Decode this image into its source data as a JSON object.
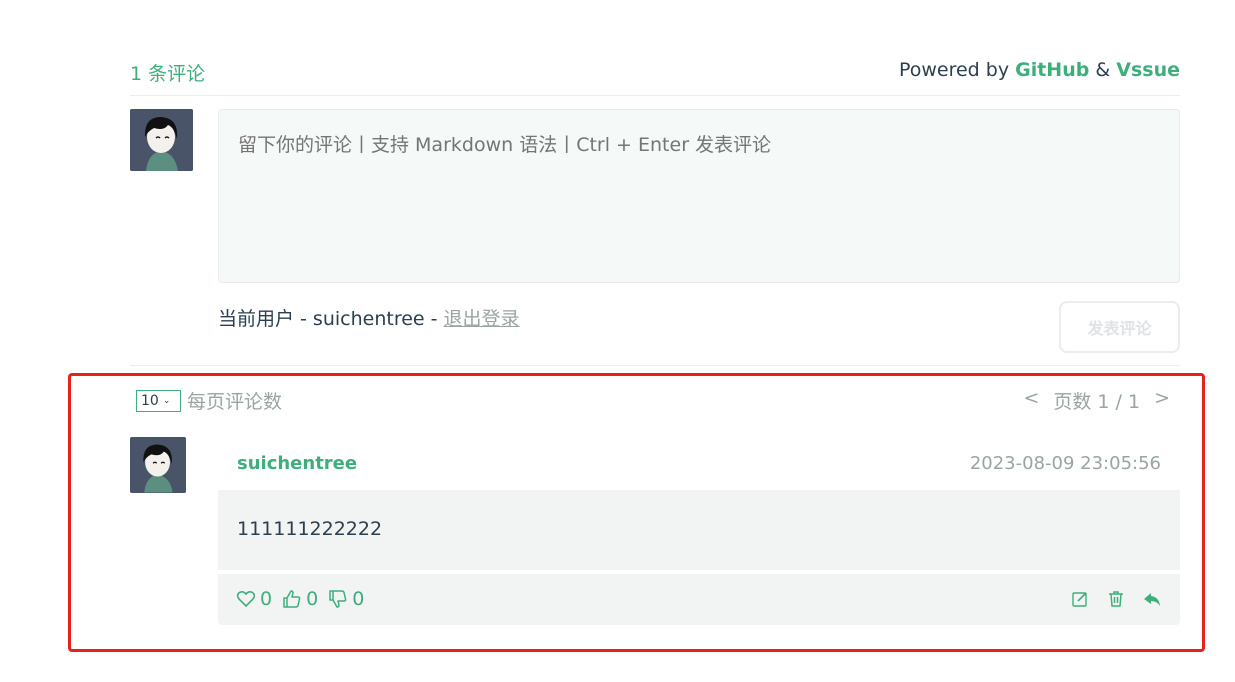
{
  "header": {
    "comment_count": "1 条评论",
    "powered_prefix": "Powered by",
    "github": "GitHub",
    "amp": "&",
    "vssue": "Vssue"
  },
  "editor": {
    "placeholder": "留下你的评论丨支持 Markdown 语法丨Ctrl + Enter 发表评论"
  },
  "current_user": {
    "prefix": "当前用户 - suichentree - ",
    "logout": "退出登录"
  },
  "submit_label": "发表评论",
  "pagination": {
    "per_page_value": "10",
    "per_page_label": "每页评论数",
    "prev": "<",
    "page_text": "页数 1 / 1",
    "next": ">"
  },
  "comments": [
    {
      "author": "suichentree",
      "time": "2023-08-09 23:05:56",
      "body": "111111222222",
      "hearts": "0",
      "likes": "0",
      "dislikes": "0"
    }
  ],
  "colors": {
    "accent": "#3eaf7c",
    "highlight": "#e5231b"
  },
  "icons": [
    "heart-icon",
    "thumbs-up-icon",
    "thumbs-down-icon",
    "edit-icon",
    "trash-icon",
    "reply-icon"
  ]
}
